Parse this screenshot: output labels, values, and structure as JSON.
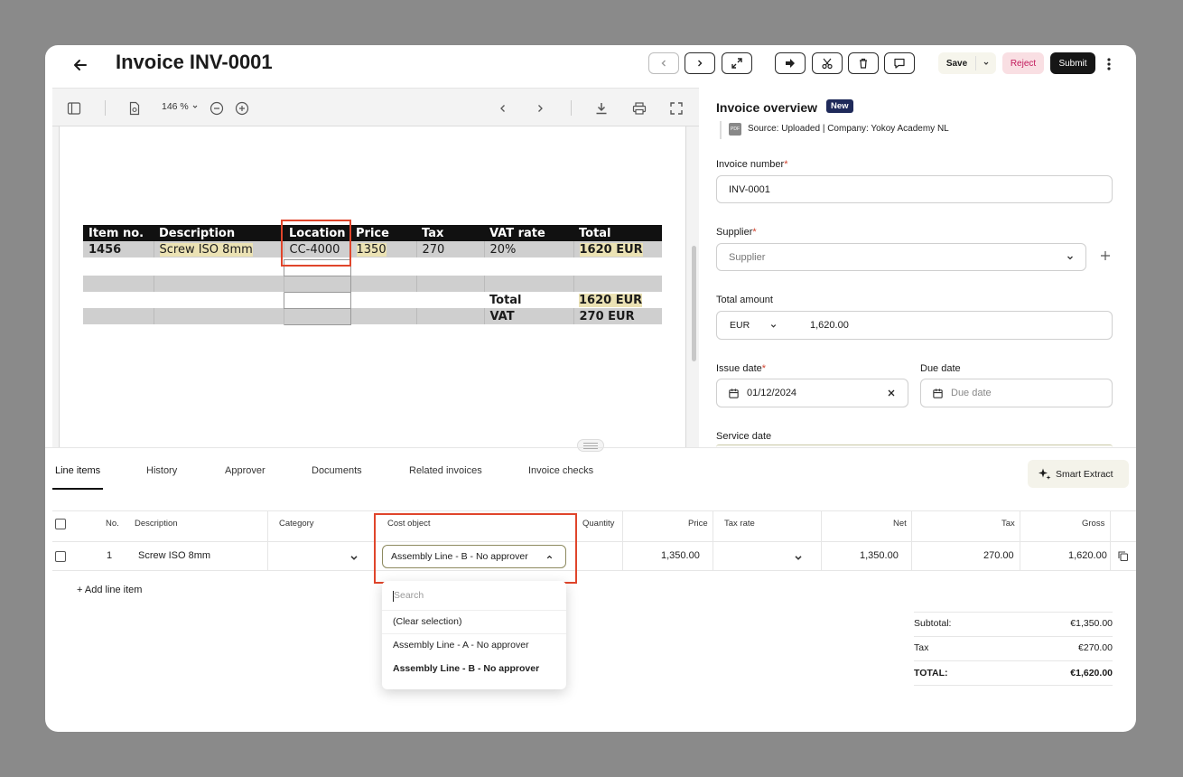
{
  "header": {
    "title": "Invoice INV-0001",
    "save": "Save",
    "reject": "Reject",
    "submit": "Submit"
  },
  "viewer": {
    "zoom": "146 %",
    "table": {
      "headers": [
        "Item no.",
        "Description",
        "Location",
        "Price",
        "Tax",
        "VAT rate",
        "Total"
      ],
      "row": [
        "1456",
        "Screw ISO 8mm",
        "CC-4000",
        "1350",
        "270",
        "20%",
        "1620 EUR"
      ],
      "total_label": "Total",
      "total_value": "1620 EUR",
      "vat_label": "VAT",
      "vat_value": "270 EUR"
    }
  },
  "overview": {
    "title": "Invoice overview",
    "badge": "New",
    "source": "Source: Uploaded | Company: Yokoy Academy NL",
    "invoice_number_label": "Invoice number",
    "invoice_number_value": "INV-0001",
    "supplier_label": "Supplier",
    "supplier_placeholder": "Supplier",
    "total_amount_label": "Total amount",
    "currency": "EUR",
    "amount": "1,620.00",
    "issue_date_label": "Issue date",
    "issue_date_value": "01/12/2024",
    "due_date_label": "Due date",
    "due_date_placeholder": "Due date",
    "service_date_label": "Service date",
    "required_mark": "*"
  },
  "tabs": [
    "Line items",
    "History",
    "Approver",
    "Documents",
    "Related invoices",
    "Invoice checks"
  ],
  "smart_extract": "Smart Extract",
  "line_items": {
    "columns": [
      "No.",
      "Description",
      "Category",
      "Cost object",
      "Quantity",
      "Price",
      "Tax rate",
      "Net",
      "Tax",
      "Gross"
    ],
    "row": {
      "no": "1",
      "description": "Screw ISO 8mm",
      "cost_object": "Assembly Line - B - No approver",
      "price": "1,350.00",
      "net": "1,350.00",
      "tax": "270.00",
      "gross": "1,620.00"
    },
    "add_line_item": "+ Add line item"
  },
  "dropdown": {
    "search_placeholder": "Search",
    "options": [
      "(Clear selection)",
      "Assembly Line - A - No approver",
      "Assembly Line - B - No approver"
    ]
  },
  "summary": {
    "subtotal_label": "Subtotal:",
    "subtotal_value": "€1,350.00",
    "tax_label": "Tax",
    "tax_value": "€270.00",
    "total_label": "TOTAL:",
    "total_value": "€1,620.00"
  },
  "colors": {
    "highlight": "#e0452b",
    "badge": "#1f2a5a",
    "reject_bg": "#f9dfe3",
    "reject_text": "#c2185b",
    "save_bg": "#f6f5ec"
  }
}
